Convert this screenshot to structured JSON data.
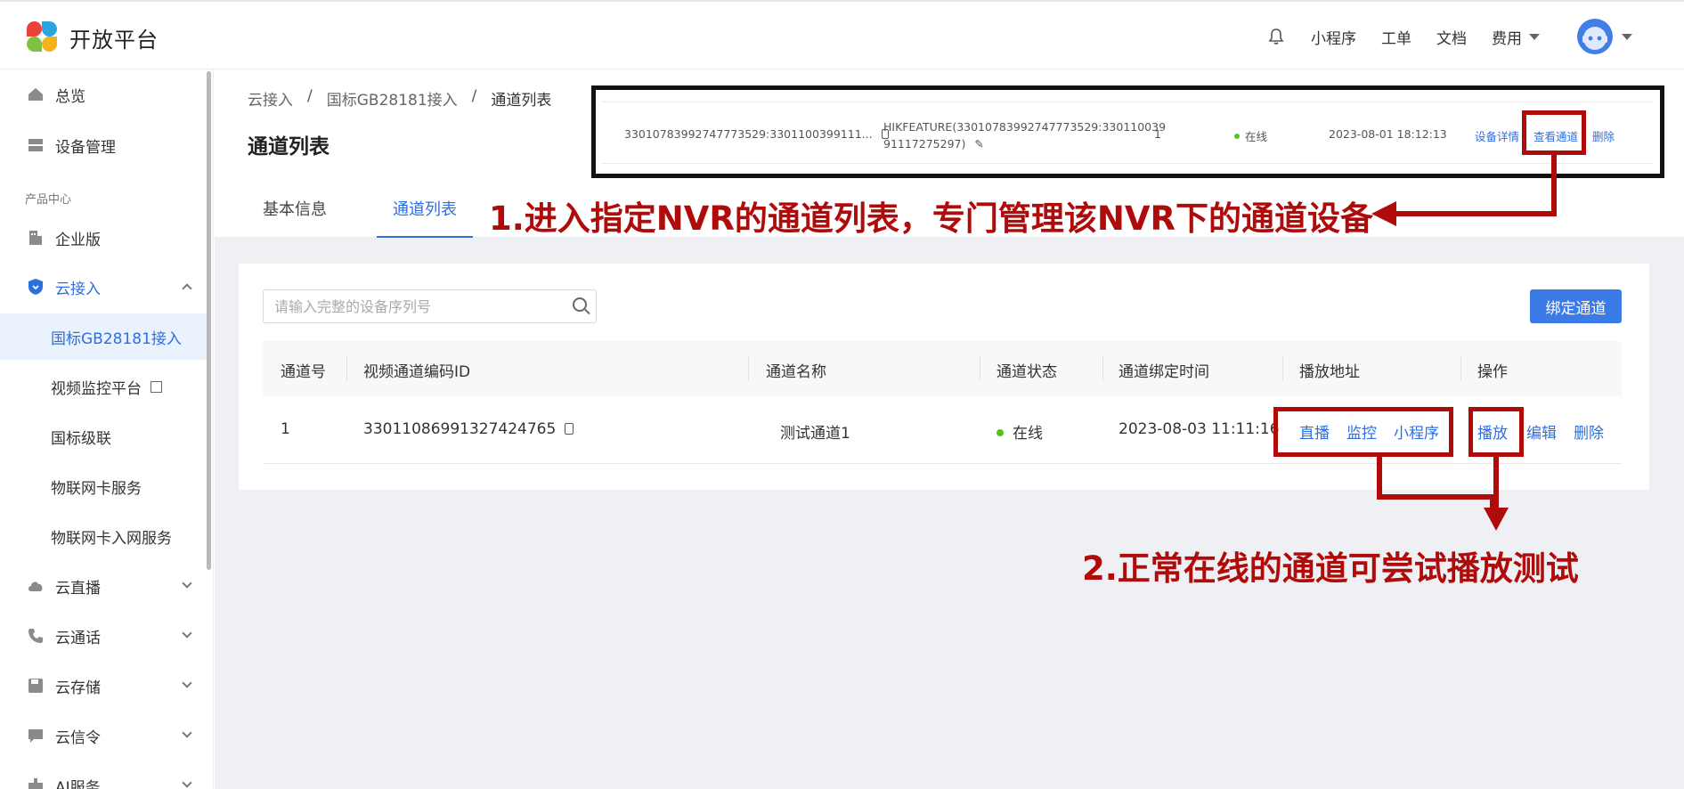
{
  "header": {
    "logo_text": "开放平台",
    "nav": [
      "小程序",
      "工单",
      "文档"
    ],
    "fee_label": "费用"
  },
  "sidebar": {
    "overview": "总览",
    "device_mgmt": "设备管理",
    "section_product": "产品中心",
    "enterprise": "企业版",
    "cloud_access": "云接入",
    "sub_items": [
      "国标GB28181接入",
      "视频监控平台",
      "国标级联",
      "物联网卡服务",
      "物联网卡入网服务"
    ],
    "cloud_live": "云直播",
    "cloud_call": "云通话",
    "cloud_storage": "云存储",
    "cloud_signal": "云信令",
    "ai_service": "AI服务"
  },
  "breadcrumb": [
    "云接入",
    "国标GB28181接入",
    "通道列表"
  ],
  "page_title": "通道列表",
  "tabs": [
    "基本信息",
    "通道列表"
  ],
  "search": {
    "placeholder": "请输入完整的设备序列号"
  },
  "bind_button": "绑定通道",
  "table": {
    "columns": [
      "通道号",
      "视频通道编码ID",
      "通道名称",
      "通道状态",
      "通道绑定时间",
      "播放地址",
      "操作"
    ],
    "rows": [
      {
        "channel_no": "1",
        "channel_id": "33011086991327424765",
        "name": "测试通道1",
        "status": "在线",
        "bind_time": "2023-08-03 11:11:16",
        "play_links": [
          "直播",
          "监控",
          "小程序"
        ],
        "actions": [
          "播放",
          "编辑",
          "删除"
        ]
      }
    ]
  },
  "inset_row": {
    "serial": "33010783992747773529:3301100399111...",
    "name_line1": "HIKFEATURE(33010783992747773529:330110039",
    "name_line2": "91117275297)",
    "count": "1",
    "status": "在线",
    "time": "2023-08-01 18:12:13",
    "actions": [
      "设备详情",
      "查看通道",
      "删除"
    ]
  },
  "annotations": {
    "note1": "1.进入指定NVR的通道列表，专门管理该NVR下的通道设备",
    "note2": "2.正常在线的通道可尝试播放测试",
    "color": "#b00b0b"
  }
}
